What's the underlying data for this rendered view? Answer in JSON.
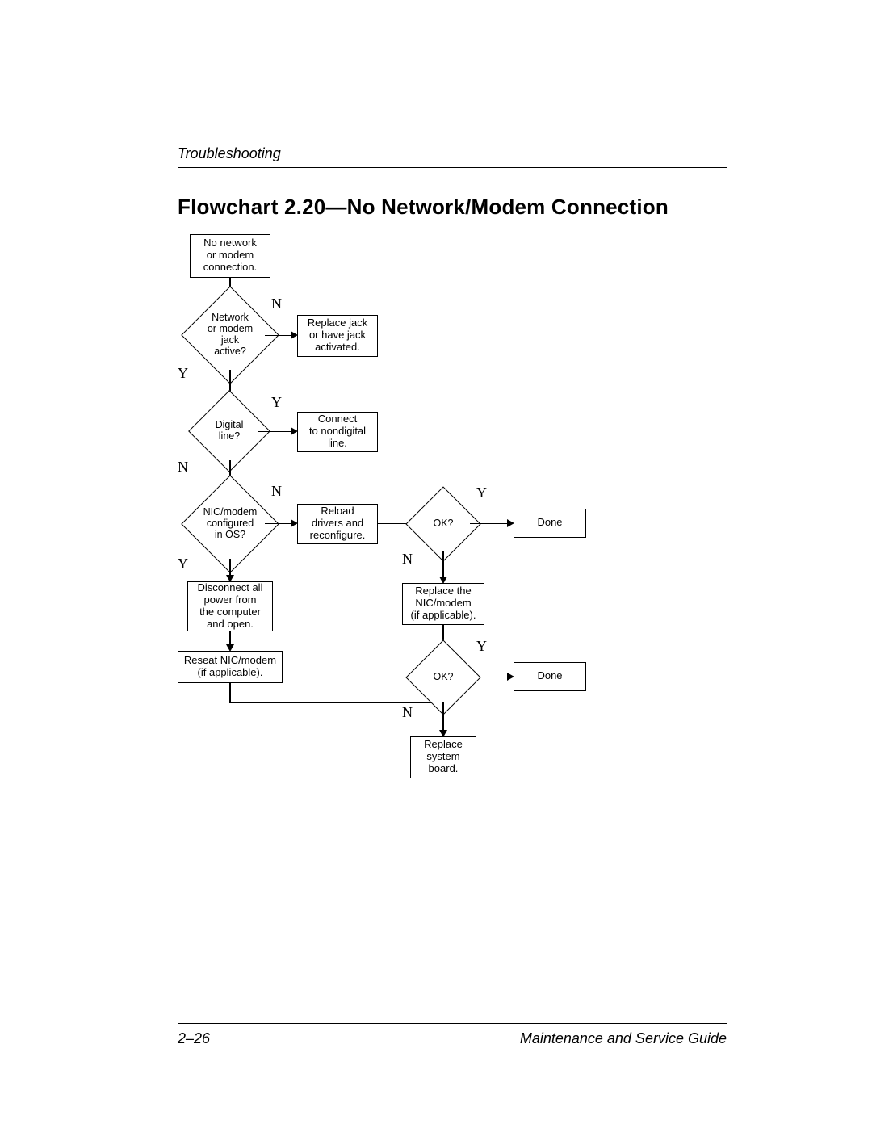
{
  "header": "Troubleshooting",
  "title": "Flowchart 2.20—No Network/Modem Connection",
  "nodes": {
    "start": "No network\nor modem\nconnection.",
    "d1": "Network\nor modem jack\nactive?",
    "b1": "Replace jack\nor have jack\nactivated.",
    "d2": "Digital\nline?",
    "b2": "Connect\nto nondigital\nline.",
    "d3": "NIC/modem\nconfigured\nin OS?",
    "b3": "Reload\ndrivers and\nreconfigure.",
    "d4": "OK?",
    "done1": "Done",
    "b4": "Disconnect all\npower from\nthe computer\nand open.",
    "b5": "Reseat NIC/modem\n(if applicable).",
    "b6": "Replace the\nNIC/modem\n(if applicable).",
    "d5": "OK?",
    "done2": "Done",
    "b7": "Replace\nsystem\nboard."
  },
  "labels": {
    "y": "Y",
    "n": "N"
  },
  "footer": {
    "left": "2–26",
    "right": "Maintenance and Service Guide"
  }
}
